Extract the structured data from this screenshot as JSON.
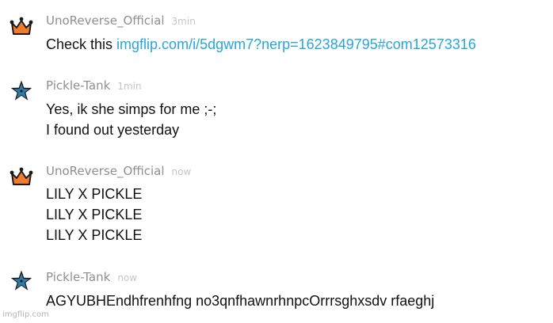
{
  "messages": [
    {
      "user": "UnoReverse_Official",
      "avatar_icon": "crown-icon",
      "time": "3min",
      "text_prefix": "Check this ",
      "link": "imgflip.com/i/5dgwm7?nerp=1623849795#com12573316"
    },
    {
      "user": "Pickle-Tank",
      "avatar_icon": "star-icon",
      "time": "1min",
      "lines": [
        "Yes, ik she simps for me ;-;",
        "I found out yesterday"
      ]
    },
    {
      "user": "UnoReverse_Official",
      "avatar_icon": "crown-icon",
      "time": "now",
      "lines": [
        "LILY X PICKLE",
        "LILY X PICKLE",
        "LILY X PICKLE"
      ]
    },
    {
      "user": "Pickle-Tank",
      "avatar_icon": "star-icon",
      "time": "now",
      "lines": [
        "AGYUBHEndhfrenhfng no3qnfhawnrhnpcOrrrsghxsdv rfaeghj"
      ]
    }
  ],
  "watermark": "imgflip.com",
  "colors": {
    "crown": "#f07b2c",
    "star": "#2e7ca8",
    "link": "#29a6d8",
    "username": "#8f8f8f",
    "timestamp": "#c6c6c6"
  }
}
